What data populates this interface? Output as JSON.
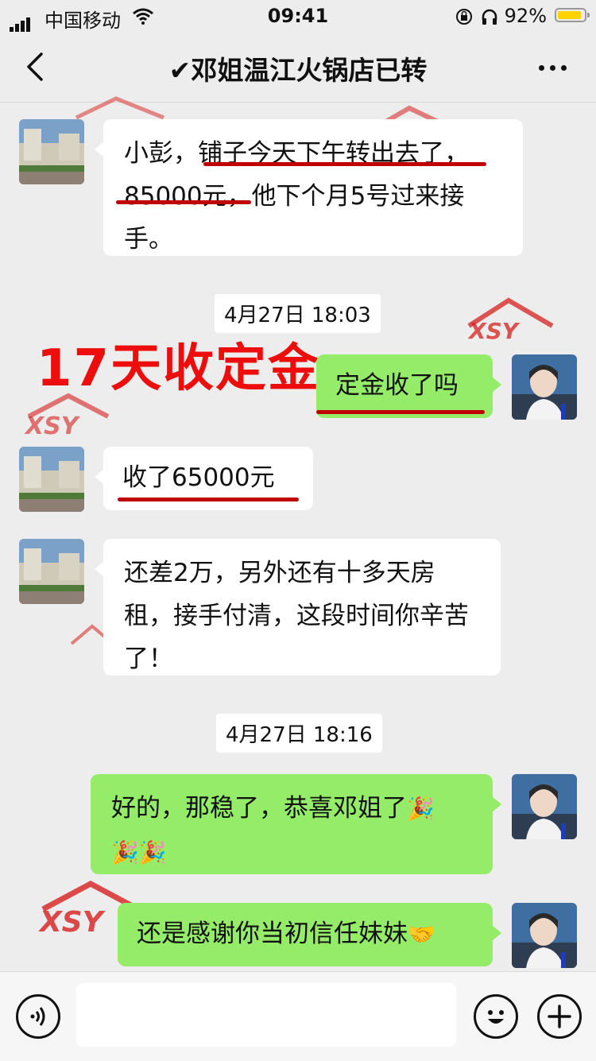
{
  "status_bar": {
    "carrier": "中国移动",
    "time": "09:41",
    "battery_percent": "92%",
    "battery_level": 0.92,
    "icons": [
      "signal-icon",
      "wifi-icon",
      "lock-rotation-icon",
      "headphones-icon",
      "battery-icon"
    ]
  },
  "nav": {
    "title": "邓姐温江火锅店已转",
    "title_check": "✔",
    "icons": [
      "back-chevron-icon",
      "more-dots-icon"
    ]
  },
  "overlay": {
    "caption": "17天收定金",
    "watermark_text": "XSY",
    "watermark_color": "#d6201e"
  },
  "messages": [
    {
      "side": "left",
      "text": "小彭，铺子今天下午转出去了，85000元，他下个月5号过来接手。"
    },
    {
      "timestamp": "4月27日 18:03"
    },
    {
      "side": "right",
      "text": "定金收了吗"
    },
    {
      "side": "left",
      "text": "收了65000元"
    },
    {
      "side": "left",
      "text": "还差2万，另外还有十多天房租，接手付清，这段时间你辛苦了！"
    },
    {
      "timestamp": "4月27日 18:16"
    },
    {
      "side": "right",
      "text": "好的，那稳了，恭喜邓姐了",
      "emoji": "🎉",
      "emoji_line2": "🎉🎉"
    },
    {
      "side": "right",
      "text": "还是感谢你当初信任妹妹",
      "emoji": "🤝"
    }
  ],
  "input_bar": {
    "icons": [
      "voice-icon",
      "emoji-icon",
      "plus-icon"
    ]
  },
  "colors": {
    "bubble_right": "#95ec69",
    "bubble_left": "#ffffff",
    "underline": "#c00000",
    "caption": "#ee0d0d",
    "background": "#ededed"
  }
}
